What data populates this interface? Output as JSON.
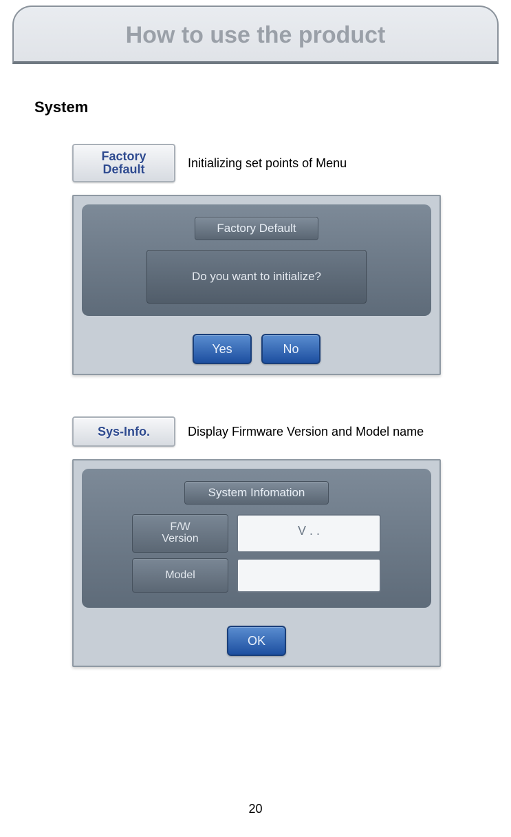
{
  "header": {
    "title": "How to use the product"
  },
  "section": {
    "heading": "System"
  },
  "items": [
    {
      "button_label": "Factory\nDefault",
      "description": "Initializing set points of Menu",
      "dialog": {
        "title": "Factory Default",
        "message": "Do you want to initialize?",
        "yes": "Yes",
        "no": "No"
      }
    },
    {
      "button_label": "Sys-Info.",
      "description": "Display Firmware Version and Model name",
      "info": {
        "title": "System Infomation",
        "rows": [
          {
            "label": "F/W\nVersion",
            "value": "V . ."
          },
          {
            "label": "Model",
            "value": ""
          }
        ],
        "ok": "OK"
      }
    }
  ],
  "page_number": "20"
}
